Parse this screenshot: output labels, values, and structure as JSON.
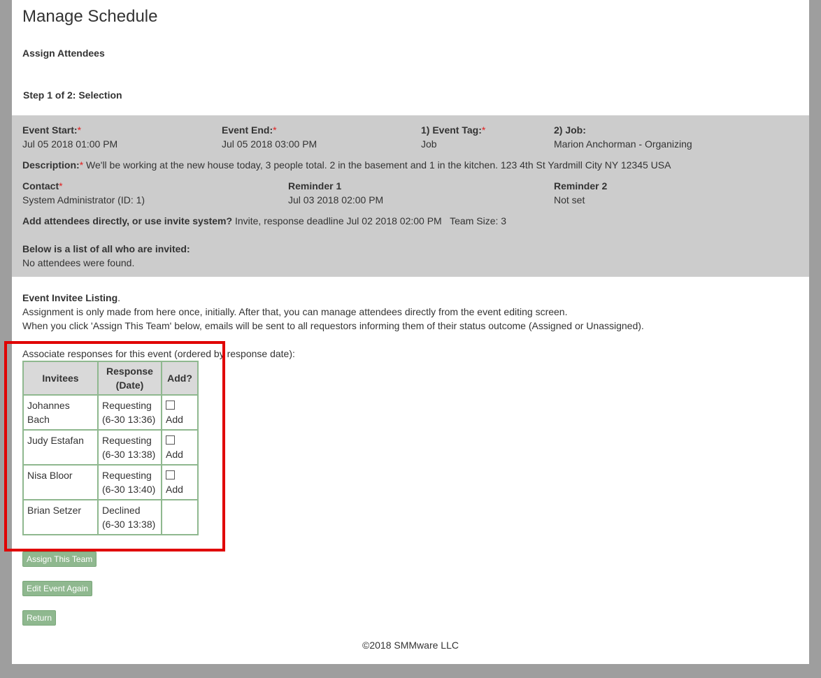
{
  "header": {
    "title": "Manage Schedule",
    "section": "Assign Attendees",
    "step": "Step 1 of 2: Selection"
  },
  "event": {
    "start_label": "Event Start:",
    "start_value": "Jul 05 2018 01:00 PM",
    "end_label": "Event End:",
    "end_value": "Jul 05 2018 03:00 PM",
    "tag_label": "1) Event Tag:",
    "tag_value": "Job",
    "job_label": "2) Job:",
    "job_value": "Marion Anchorman - Organizing",
    "desc_label": "Description:",
    "desc_value": "We'll be working at the new house today, 3 people total. 2 in the basement and 1 in the kitchen. 123 4th St Yardmill City NY 12345 USA",
    "contact_label": "Contact",
    "contact_value": "System Administrator (ID: 1)",
    "reminder1_label": "Reminder 1",
    "reminder1_value": "Jul 03 2018 02:00 PM",
    "reminder2_label": "Reminder 2",
    "reminder2_value": "Not set",
    "attendees_q": "Add attendees directly, or use invite system?",
    "attendees_a": "Invite, response deadline Jul 02 2018 02:00 PM   Team Size: 3",
    "invited_label": "Below is a list of all who are invited:",
    "invited_value": "No attendees were found.",
    "required_mark": "*"
  },
  "listing": {
    "title": "Event Invitee Listing",
    "title_suffix": ".",
    "line1": "Assignment is only made from here once, initially. After that, you can manage attendees directly from the event editing screen.",
    "line2": "When you click 'Assign This Team' below, emails will be sent to all requestors informing them of their status outcome (Assigned or Unassigned).",
    "associate": "Associate responses for this event (ordered by response date):"
  },
  "table": {
    "headers": [
      "Invitees",
      "Response\n(Date)",
      "Add?"
    ],
    "header_invitees": "Invitees",
    "header_response_1": "Response",
    "header_response_2": "(Date)",
    "header_add": "Add?",
    "rows": [
      {
        "name": "Johannes Bach",
        "status": "Requesting",
        "date": "(6-30 13:36)",
        "add": "Add"
      },
      {
        "name": "Judy Estafan",
        "status": "Requesting",
        "date": "(6-30 13:38)",
        "add": "Add"
      },
      {
        "name": "Nisa Bloor",
        "status": "Requesting",
        "date": "(6-30 13:40)",
        "add": "Add"
      },
      {
        "name": "Brian Setzer",
        "status": "Declined",
        "date": "(6-30 13:38)",
        "add": ""
      }
    ]
  },
  "buttons": {
    "assign": "Assign This Team",
    "edit": "Edit Event Again",
    "return": "Return"
  },
  "footer": "©2018 SMMware LLC",
  "colors": {
    "panel": "#cccccc",
    "button": "#8fb88f",
    "required": "#e02020",
    "highlight": "#e00000"
  }
}
